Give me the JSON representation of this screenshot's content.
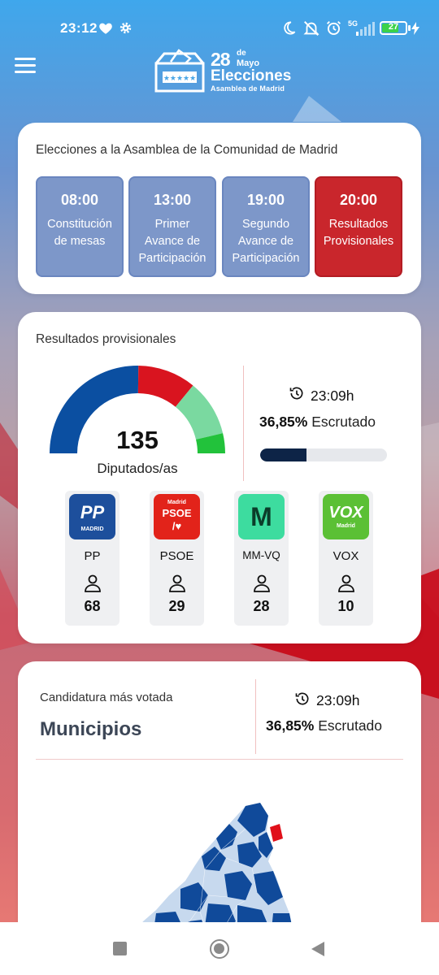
{
  "status_bar": {
    "time": "23:12",
    "battery": "27",
    "network": "5G",
    "icons": [
      "heart-icon",
      "gear-icon",
      "moon-icon",
      "mute-icon",
      "alarm-icon",
      "signal-icon",
      "battery-icon",
      "charging-icon"
    ]
  },
  "header": {
    "logo": {
      "date_number": "28",
      "date_de": "de",
      "date_month": "Mayo",
      "title": "Elecciones",
      "subtitle": "Asamblea de Madrid"
    },
    "menu_icon": "hamburger-menu-icon"
  },
  "timeline": {
    "title": "Elecciones a la Asamblea de la Comunidad de Madrid",
    "phases": [
      {
        "time": "08:00",
        "label": "Constitución de mesas",
        "active": false
      },
      {
        "time": "13:00",
        "label": "Primer Avance de Participación",
        "active": false
      },
      {
        "time": "19:00",
        "label": "Segundo Avance de Participación",
        "active": false
      },
      {
        "time": "20:00",
        "label": "Resultados Provisionales",
        "active": true
      }
    ]
  },
  "results": {
    "title": "Resultados provisionales",
    "total_seats": "135",
    "total_label": "Diputados/as",
    "update_time": "23:09h",
    "scrutinized_pct": "36,85%",
    "scrutinized_label": "Escrutado",
    "progress_fraction": 0.3685,
    "parties": [
      {
        "name": "PP",
        "seats": "68",
        "color": "#1d4f9c",
        "logo_text": "PP",
        "logo_sub": "MADRID"
      },
      {
        "name": "PSOE",
        "seats": "29",
        "color": "#e2231a",
        "logo_text": "PSOE",
        "logo_sub": "Madrid"
      },
      {
        "name": "MM-VQ",
        "seats": "28",
        "color": "#3ddc9f",
        "logo_text": "M",
        "logo_sub": ""
      },
      {
        "name": "VOX",
        "seats": "10",
        "color": "#5bc035",
        "logo_text": "VOX",
        "logo_sub": "Madrid"
      }
    ],
    "gauge_colors": [
      "#0b4fa1",
      "#d9141f",
      "#7ad9a0",
      "#22c23b"
    ]
  },
  "municipios": {
    "title": "Candidatura más votada",
    "heading": "Municipios",
    "update_time": "23:09h",
    "scrutinized_pct": "36,85%",
    "scrutinized_label": "Escrutado",
    "map_colors": [
      "#104a9a",
      "#c7d9ee",
      "#e0101a"
    ]
  },
  "nav": {
    "buttons": [
      "recent-apps-button",
      "home-button",
      "back-button"
    ]
  }
}
